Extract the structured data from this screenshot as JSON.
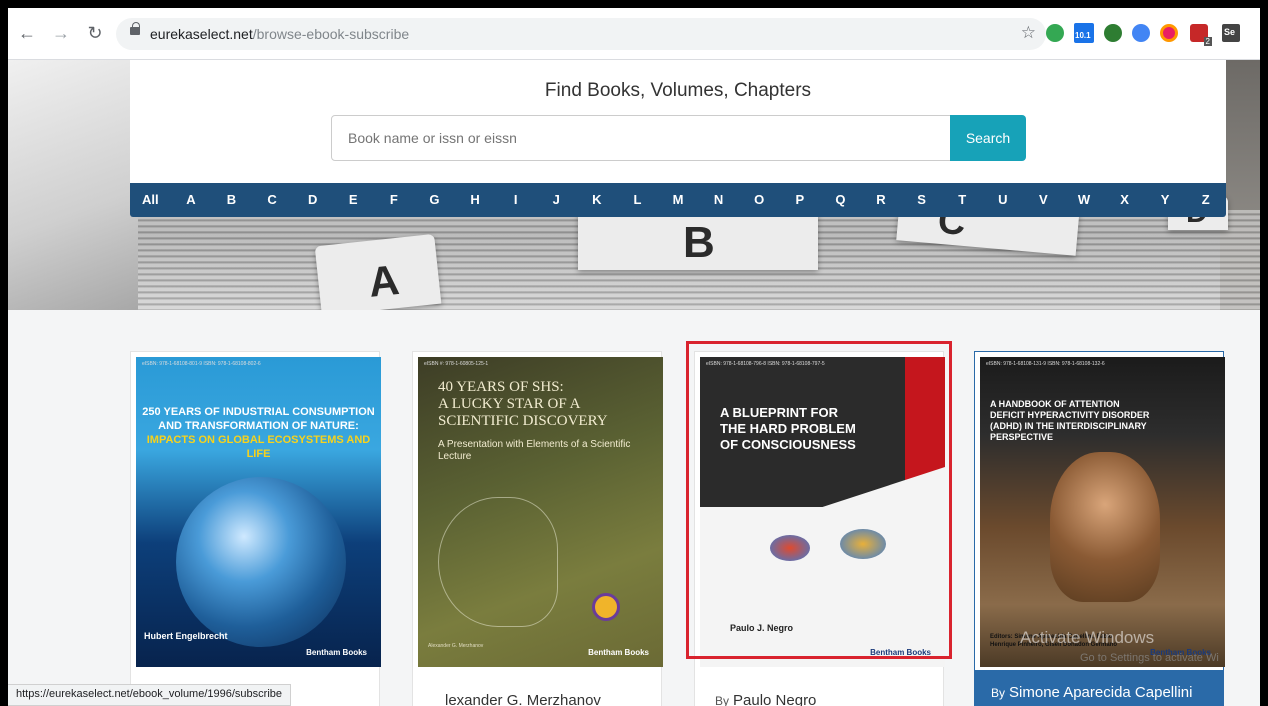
{
  "browser": {
    "back_icon": "arrow-left-icon",
    "forward_icon": "arrow-right-icon",
    "reload_icon": "reload-icon",
    "url_domain": "eurekaselect.net",
    "url_path": "/browse-ebook-subscribe",
    "extension_badge": "10.1",
    "extension_badge2": "2",
    "extension_badge3": "Se"
  },
  "search": {
    "title": "Find Books, Volumes, Chapters",
    "placeholder": "Book name or issn or eissn",
    "button_label": "Search"
  },
  "alphabet": [
    "All",
    "A",
    "B",
    "C",
    "D",
    "E",
    "F",
    "G",
    "H",
    "I",
    "J",
    "K",
    "L",
    "M",
    "N",
    "O",
    "P",
    "Q",
    "R",
    "S",
    "T",
    "U",
    "V",
    "W",
    "X",
    "Y",
    "Z"
  ],
  "hero_letters": [
    "A",
    "B",
    "C",
    "D"
  ],
  "books": [
    {
      "cover_title_line1": "250 YEARS OF INDUSTRIAL CONSUMPTION",
      "cover_title_line2": "AND TRANSFORMATION OF NATURE:",
      "cover_title_line3": "IMPACTS ON GLOBAL ECOSYSTEMS AND LIFE",
      "cover_author": "Hubert Engelbrecht",
      "publisher": "Bentham Books",
      "isbn": "eISBN: 978-1-68108-801-9 ISBN: 978-1-68108-802-6",
      "by": "",
      "author": ""
    },
    {
      "cover_title_line1": "40 YEARS OF SHS:",
      "cover_title_line2": "A LUCKY STAR OF A",
      "cover_title_line3": "SCIENTIFIC DISCOVERY",
      "cover_subtitle": "A Presentation with Elements of a Scientific Lecture",
      "cover_author": "Alexander G. Merzhanov",
      "publisher": "Bentham Books",
      "isbn": "eISBN #: 978-1-60805-125-1",
      "author": "lexander G. Merzhanov"
    },
    {
      "cover_title_line1": "A BLUEPRINT FOR",
      "cover_title_line2": "THE HARD PROBLEM",
      "cover_title_line3": "OF CONSCIOUSNESS",
      "cover_author": "Paulo J. Negro",
      "publisher": "Bentham Books",
      "isbn": "eISBN: 978-1-68108-796-8 ISBN: 978-1-68108-797-5",
      "by": "By",
      "author": "Paulo Negro"
    },
    {
      "cover_title_line1": "A HANDBOOK OF ATTENTION",
      "cover_title_line2": "DEFICIT HYPERACTIVITY DISORDER",
      "cover_title_line3": "(ADHD) IN THE INTERDISCIPLINARY",
      "cover_title_line4": "PERSPECTIVE",
      "cover_editors": "Editors: Simone Aparecida Capellini, Fábio Henrique Pinheiro, Giseli Donadon Germano",
      "publisher": "Bentham Books",
      "isbn": "eISBN: 978-1-68108-131-9 ISBN: 978-1-68108-132-6",
      "by": "By",
      "author": "Simone Aparecida Capellini"
    }
  ],
  "status_bar_url": "https://eurekaselect.net/ebook_volume/1996/subscribe",
  "watermark": "Activate Windows",
  "watermark_sub": "Go to Settings to activate Wi",
  "colors": {
    "accent": "#17a2b8",
    "alphabet_bar": "#1f4f7a",
    "highlight_box": "#d9232e",
    "card4_footer": "#2a6aa8"
  }
}
